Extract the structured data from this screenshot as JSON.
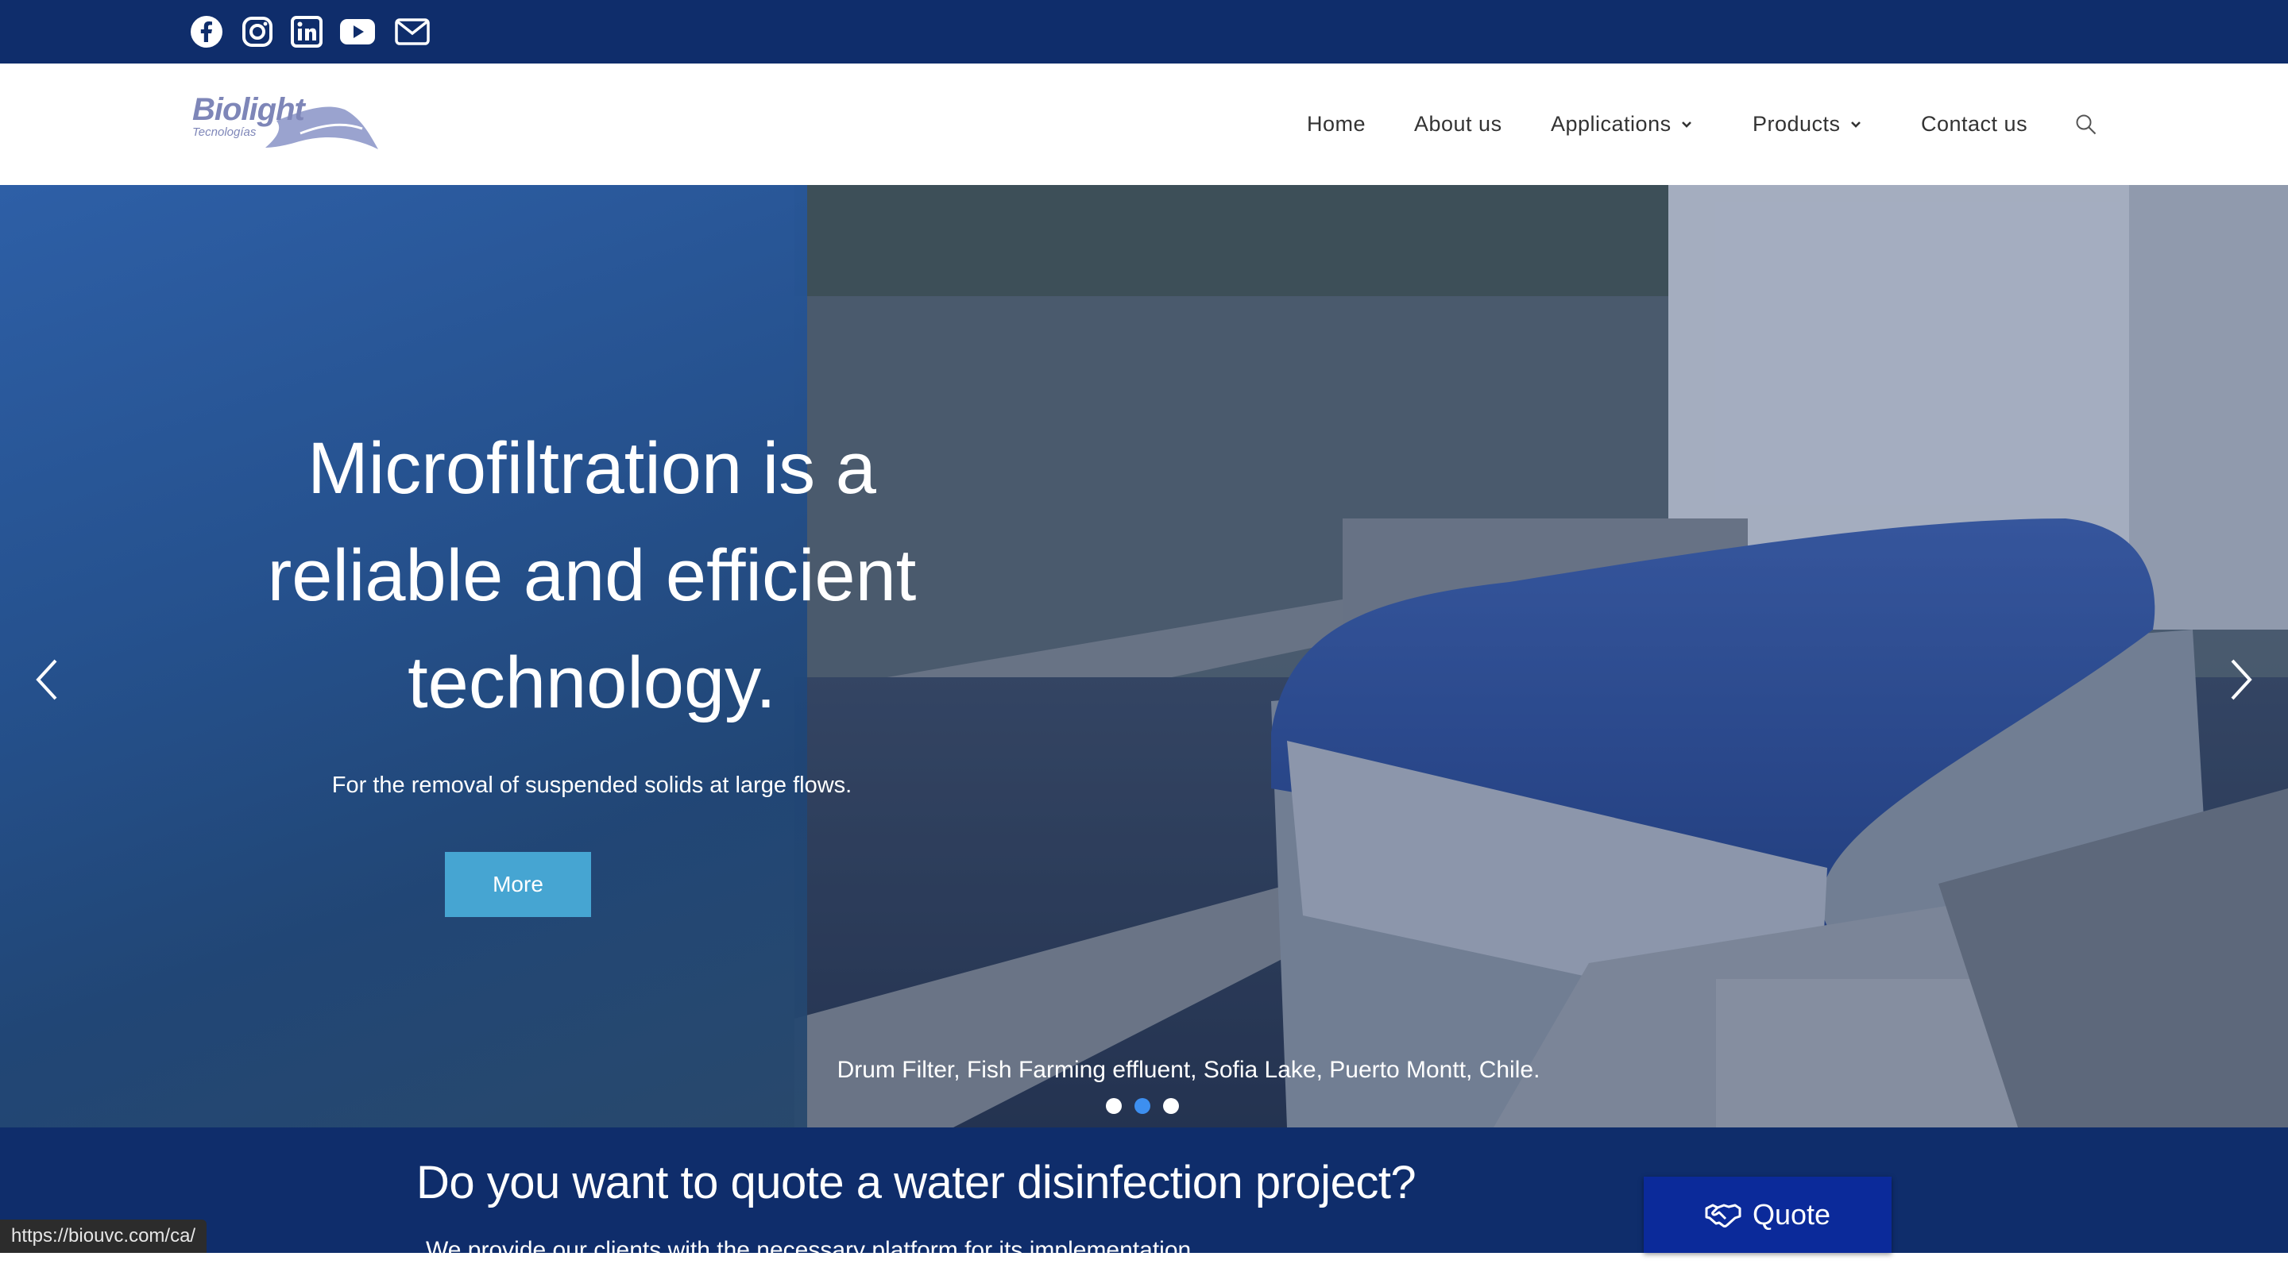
{
  "social": {
    "items": [
      {
        "name": "facebook-icon"
      },
      {
        "name": "instagram-icon"
      },
      {
        "name": "linkedin-icon"
      },
      {
        "name": "youtube-icon"
      },
      {
        "name": "email-icon"
      }
    ],
    "bar_color": "#0f2d6b"
  },
  "header": {
    "logo_text": "Biolight",
    "logo_sub": "Tecnologías",
    "nav": {
      "home": "Home",
      "about": "About us",
      "applications": "Applications",
      "products": "Products",
      "contact": "Contact us"
    }
  },
  "hero": {
    "headline_1": "Microfiltration is a",
    "headline_2": "reliable and efficient",
    "headline_3": "technology.",
    "subline": "For the removal of suspended solids at large flows.",
    "button": "More",
    "caption": "Drum Filter, Fish Farming effluent, Sofia Lake, Puerto Montt, Chile.",
    "active_slide": 2,
    "slide_count": 3,
    "accent": "#46a5d2"
  },
  "quote": {
    "title": "Do you want to quote a water disinfection project?",
    "subtitle": "We provide our clients with the necessary platform for its implementation.",
    "button": "Quote"
  },
  "status": {
    "url": "https://biouvc.com/ca/"
  }
}
